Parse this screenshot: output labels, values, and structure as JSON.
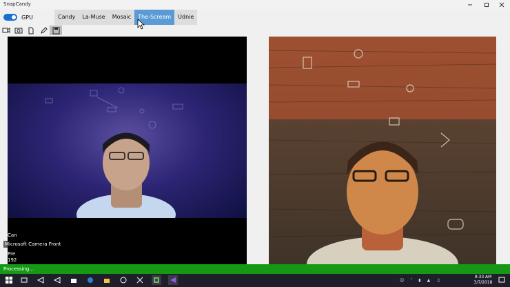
{
  "window": {
    "title": "SnapCandy",
    "minimize_icon": "minimize-icon",
    "maximize_icon": "maximize-icon",
    "close_icon": "close-icon"
  },
  "gpu_toggle": {
    "label": "GPU",
    "state": "on",
    "color": "#1a6fd1"
  },
  "styles": {
    "tabs": [
      {
        "label": "Candy"
      },
      {
        "label": "La-Muse"
      },
      {
        "label": "Mosaic"
      },
      {
        "label": "The-Scream"
      },
      {
        "label": "Udnie"
      }
    ],
    "selected": "The-Scream",
    "active_color": "#5b9bd5"
  },
  "toolbar_icons": [
    "video-icon",
    "camera-icon",
    "file-icon",
    "pen-icon",
    "save-icon"
  ],
  "camera_panel": {
    "label": "Microsoft Camera Front",
    "partial_labels": [
      "Can",
      "Pre",
      "192"
    ]
  },
  "status": {
    "text": "Processing...",
    "color": "#159915"
  },
  "taskbar": {
    "icons": [
      "start-icon",
      "task-view-icon",
      "visual-studio-icon",
      "visual-studio-icon-2",
      "store-icon",
      "edge-icon",
      "file-explorer-icon",
      "browser-icon",
      "tool-icon",
      "app-icon",
      "visual-studio-icon-3"
    ],
    "clock_time": "9:33 AM",
    "clock_date": "3/7/2018"
  }
}
